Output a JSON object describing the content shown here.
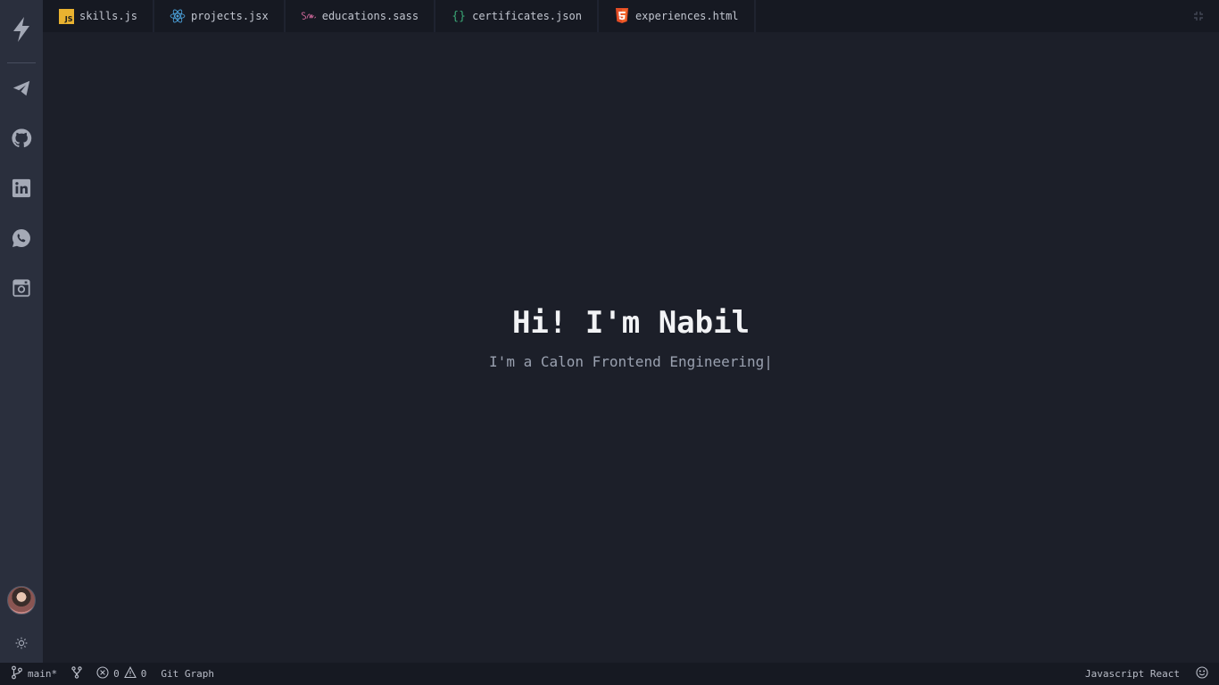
{
  "activity_bar": {
    "items": [
      {
        "name": "telegram",
        "icon": "paper-plane-icon"
      },
      {
        "name": "github",
        "icon": "github-icon"
      },
      {
        "name": "linkedin",
        "icon": "linkedin-icon"
      },
      {
        "name": "whatsapp",
        "icon": "whatsapp-icon"
      },
      {
        "name": "instagram",
        "icon": "instagram-icon"
      }
    ],
    "logo_icon": "lightning-bolt-icon",
    "theme_icon": "sun-icon"
  },
  "tabs": [
    {
      "label": "skills.js",
      "icon": "javascript-icon",
      "icon_text": "JS"
    },
    {
      "label": "projects.jsx",
      "icon": "react-icon"
    },
    {
      "label": "educations.sass",
      "icon": "sass-icon"
    },
    {
      "label": "certificates.json",
      "icon": "json-icon",
      "icon_text": "{}"
    },
    {
      "label": "experiences.html",
      "icon": "html5-icon"
    }
  ],
  "hero": {
    "title": "Hi! I'm Nabil",
    "subtitle": "I'm a Calon Frontend Engineering",
    "caret": "|"
  },
  "statusbar": {
    "branch": "main*",
    "errors": "0",
    "warnings": "0",
    "git_graph": "Git Graph",
    "language": "Javascript React"
  },
  "colors": {
    "background": "#1c1f29",
    "activity_bar": "#2a2f3d",
    "tab_bar": "#161922",
    "js_yellow": "#e9b230",
    "react_blue": "#4a9fd8",
    "sass_pink": "#cd6799",
    "json_green": "#3aa675",
    "html_red": "#e44d26"
  }
}
